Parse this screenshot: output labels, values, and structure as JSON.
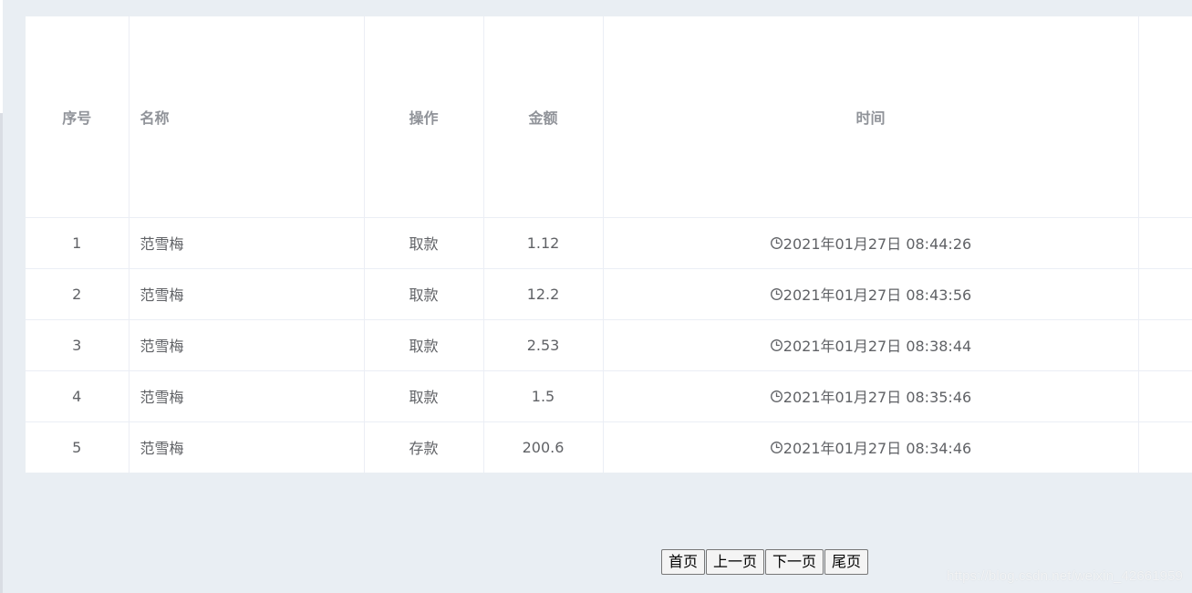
{
  "table": {
    "headers": {
      "index": "序号",
      "name": "名称",
      "operation": "操作",
      "amount": "金额",
      "time": "时间"
    },
    "rows": [
      {
        "index": "1",
        "name": "范雪梅",
        "operation": "取款",
        "amount": "1.12",
        "time": "2021年01月27日 08:44:26"
      },
      {
        "index": "2",
        "name": "范雪梅",
        "operation": "取款",
        "amount": "12.2",
        "time": "2021年01月27日 08:43:56"
      },
      {
        "index": "3",
        "name": "范雪梅",
        "operation": "取款",
        "amount": "2.53",
        "time": "2021年01月27日 08:38:44"
      },
      {
        "index": "4",
        "name": "范雪梅",
        "operation": "取款",
        "amount": "1.5",
        "time": "2021年01月27日 08:35:46"
      },
      {
        "index": "5",
        "name": "范雪梅",
        "operation": "存款",
        "amount": "200.6",
        "time": "2021年01月27日 08:34:46"
      }
    ],
    "time_icon": "clock-icon"
  },
  "pagination": {
    "first": "首页",
    "prev": "上一页",
    "next": "下一页",
    "last": "尾页"
  },
  "watermark": "https://blog.csdn.net/weixin_42661959"
}
